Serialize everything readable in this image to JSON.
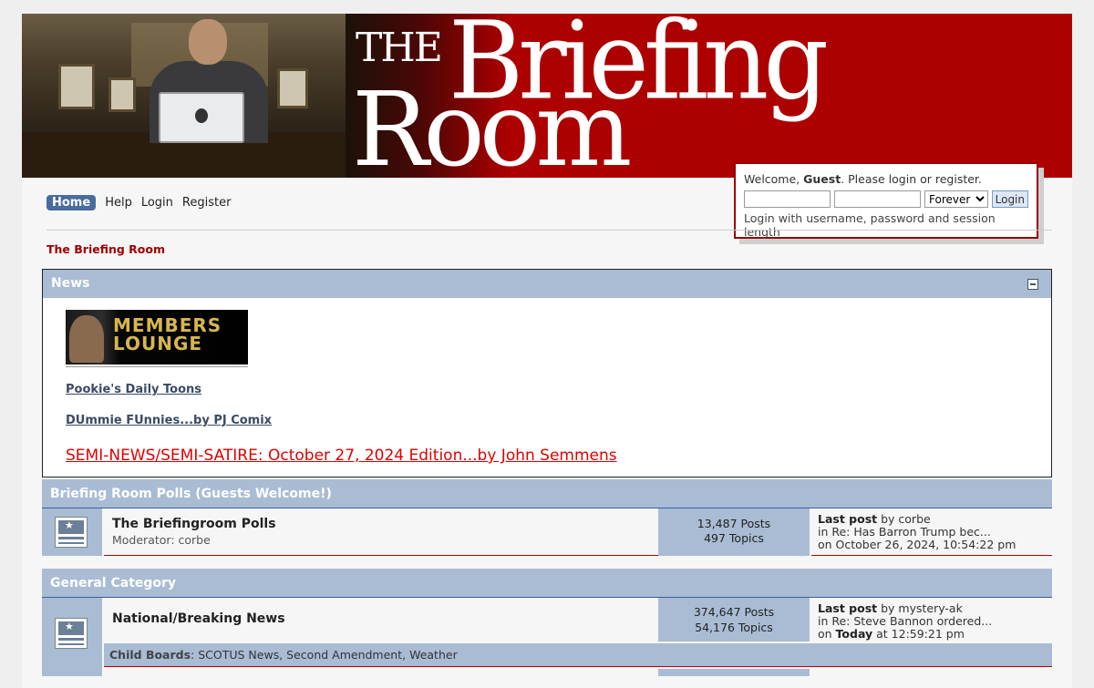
{
  "header": {
    "logo_the": "THE",
    "logo_briefing": "Briefing",
    "logo_room": "Room",
    "members_lounge_line1": "MEMBERS",
    "members_lounge_line2": "LOUNGE"
  },
  "login": {
    "welcome_prefix": "Welcome, ",
    "guest": "Guest",
    "welcome_mid": ". Please ",
    "login_link": "login",
    "or": " or ",
    "register_link": "register",
    "period": ".",
    "username_value": "",
    "password_value": "",
    "session_option": "Forever",
    "login_button": "Login",
    "note": "Login with username, password and session length"
  },
  "menu": {
    "items": [
      {
        "label": "Home",
        "active": true
      },
      {
        "label": "Help"
      },
      {
        "label": "Login"
      },
      {
        "label": "Register"
      }
    ]
  },
  "breadcrumb": "The Briefing Room",
  "news": {
    "title": "News",
    "links": [
      "Pookie's Daily Toons",
      "DUmmie FUnnies...by PJ Comix"
    ],
    "headline": "SEMI-NEWS/SEMI-SATIRE: October 27, 2024 Edition...by John Semmens"
  },
  "categories": [
    {
      "name": "Briefing Room Polls (Guests Welcome!)",
      "boards": [
        {
          "title": "The Briefingroom Polls",
          "moderator_label": "Moderator: ",
          "moderator": "corbe",
          "posts": "13,487 Posts",
          "topics": "497 Topics",
          "last_label": "Last post",
          "last_by": " by corbe",
          "last_in": "in Re: Has Barron Trump bec...",
          "last_on": "on October 26, 2024, 10:54:22 pm"
        }
      ]
    },
    {
      "name": "General Category",
      "boards": [
        {
          "title": "National/Breaking News",
          "posts": "374,647 Posts",
          "topics": "54,176 Topics",
          "last_label": "Last post",
          "last_by": " by mystery-ak",
          "last_in": "in Re: Steve Bannon ordered...",
          "last_on_prefix": "on ",
          "last_on_bold": "Today",
          "last_on_suffix": " at 12:59:21 pm",
          "child_label": "Child Boards",
          "child_boards": [
            "SCOTUS News",
            "Second Amendment",
            "Weather"
          ]
        }
      ]
    }
  ]
}
